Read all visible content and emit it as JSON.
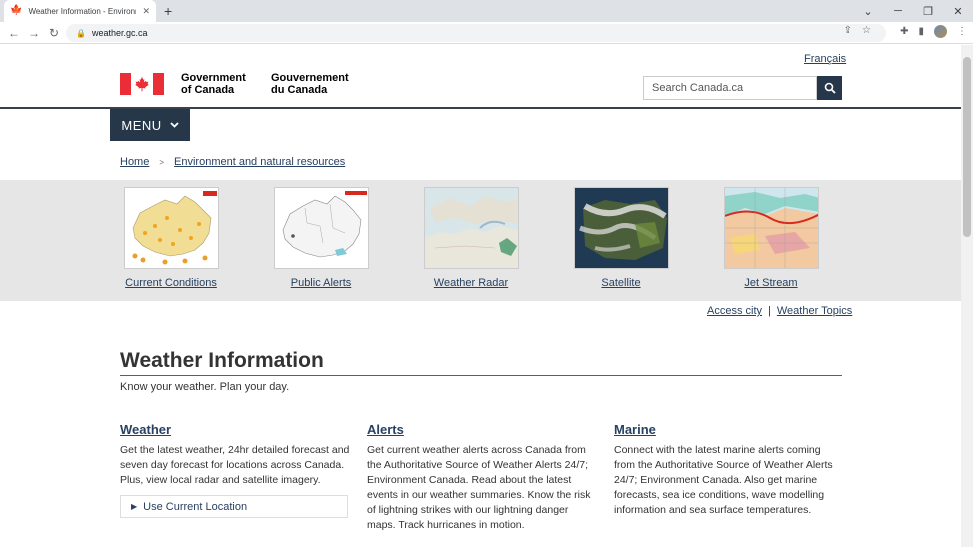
{
  "browser": {
    "tab_title": "Weather Information - Environm",
    "tab_close": "✕",
    "new_tab": "+",
    "url": "weather.gc.ca",
    "controls": {
      "minimize": "─",
      "restore": "❐",
      "close": "✕"
    }
  },
  "header": {
    "language_link": "Français",
    "gov_en_line1": "Government",
    "gov_en_line2": "of Canada",
    "gov_fr_line1": "Gouvernement",
    "gov_fr_line2": "du Canada",
    "search_placeholder": "Search Canada.ca",
    "menu_label": "MENU"
  },
  "breadcrumb": [
    "Home",
    "Environment and natural resources"
  ],
  "gallery": [
    {
      "label": "Current Conditions"
    },
    {
      "label": "Public Alerts"
    },
    {
      "label": "Weather Radar"
    },
    {
      "label": "Satellite"
    },
    {
      "label": "Jet Stream"
    }
  ],
  "quick_links": {
    "access_city": "Access city",
    "separator": "|",
    "weather_topics": "Weather Topics"
  },
  "main": {
    "title": "Weather Information",
    "tagline": "Know your weather. Plan your day.",
    "columns": [
      {
        "heading": "Weather",
        "body": "Get the latest weather, 24hr detailed forecast and seven day forecast for locations across Canada. Plus, view local radar and satellite imagery."
      },
      {
        "heading": "Alerts",
        "body": "Get current weather alerts across Canada from the Authoritative Source of Weather Alerts 24/7; Environment Canada. Read about the latest events in our weather summaries. Know the risk of lightning strikes with our lightning danger maps. Track hurricanes in motion."
      },
      {
        "heading": "Marine",
        "body": "Connect with the latest marine alerts coming from the Authoritative Source of Weather Alerts 24/7; Environment Canada. Also get marine forecasts, sea ice conditions, wave modelling information and sea surface temperatures."
      }
    ],
    "use_location": "Use Current Location"
  },
  "colors": {
    "link": "#284162",
    "dark_bar": "#26374a",
    "flag_red": "#eb2d37",
    "rule_red": "#af3c43"
  }
}
